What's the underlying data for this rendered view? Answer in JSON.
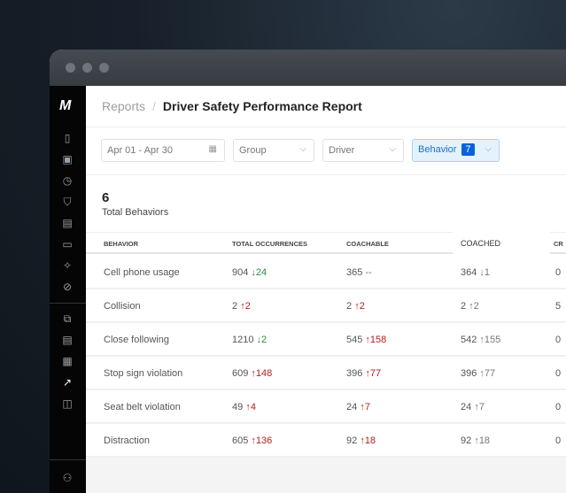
{
  "breadcrumb": {
    "parent": "Reports",
    "separator": "/",
    "current": "Driver Safety Performance Report"
  },
  "filters": {
    "date": "Apr 01 - Apr 30",
    "group": "Group",
    "driver": "Driver",
    "behavior": "Behavior",
    "behavior_count": "7"
  },
  "summary": {
    "count": "6",
    "label": "Total Behaviors"
  },
  "table": {
    "headers": [
      "BEHAVIOR",
      "TOTAL OCCURRENCES",
      "COACHABLE",
      "COACHED",
      "CR"
    ],
    "rows": [
      {
        "behavior": "Cell phone usage",
        "total": "904",
        "total_delta": "↓24",
        "total_dir": "dn",
        "coachable": "365",
        "coachable_delta": "--",
        "coachable_dir": "ne",
        "coached": "364",
        "coached_delta": "↓1",
        "last": "0"
      },
      {
        "behavior": "Collision",
        "total": "2",
        "total_delta": "↑2",
        "total_dir": "up",
        "coachable": "2",
        "coachable_delta": "↑2",
        "coachable_dir": "up",
        "coached": "2",
        "coached_delta": "↑2",
        "last": "5"
      },
      {
        "behavior": "Close following",
        "total": "1210",
        "total_delta": "↓2",
        "total_dir": "dn",
        "coachable": "545",
        "coachable_delta": "↑158",
        "coachable_dir": "up",
        "coached": "542",
        "coached_delta": "↑155",
        "last": "0"
      },
      {
        "behavior": "Stop sign violation",
        "total": "609",
        "total_delta": "↑148",
        "total_dir": "up",
        "coachable": "396",
        "coachable_delta": "↑77",
        "coachable_dir": "up",
        "coached": "396",
        "coached_delta": "↑77",
        "last": "0"
      },
      {
        "behavior": "Seat belt violation",
        "total": "49",
        "total_delta": "↑4",
        "total_dir": "up",
        "coachable": "24",
        "coachable_delta": "↑7",
        "coachable_dir": "up",
        "coached": "24",
        "coached_delta": "↑7",
        "last": "0"
      },
      {
        "behavior": "Distraction",
        "total": "605",
        "total_delta": "↑136",
        "total_dir": "up",
        "coachable": "92",
        "coachable_delta": "↑18",
        "coachable_dir": "up",
        "coached": "92",
        "coached_delta": "↑18",
        "last": "0"
      }
    ]
  },
  "sidebar": {
    "logo": "M"
  }
}
